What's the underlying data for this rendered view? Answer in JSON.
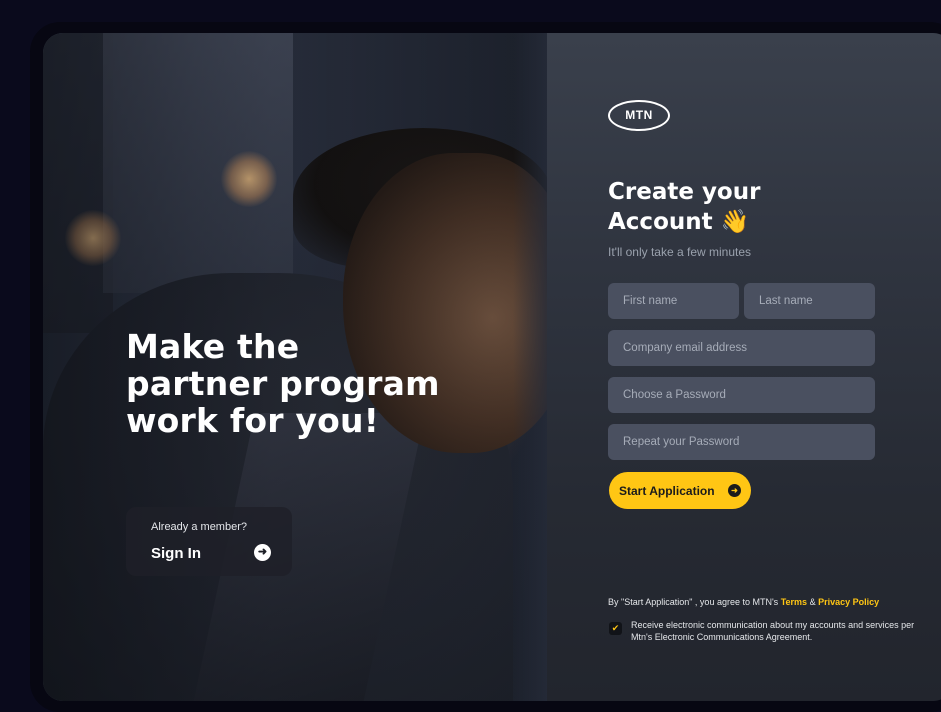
{
  "hero": {
    "headline_line1": "Make the",
    "headline_line2": "partner program",
    "headline_line3": "work for you!"
  },
  "signin": {
    "prompt": "Already a member?",
    "label": "Sign In",
    "arrow_icon": "arrow-right-circle-icon"
  },
  "form": {
    "logo_text": "MTN",
    "title_line1": "Create your",
    "title_line2": "Account",
    "title_emoji": "👋",
    "subtitle": "It'll only take a few minutes",
    "first_name_placeholder": "First name",
    "last_name_placeholder": "Last name",
    "email_placeholder": "Company email address",
    "password_placeholder": "Choose a Password",
    "repeat_password_placeholder": "Repeat your Password",
    "submit_label": "Start Application",
    "legal_prefix": "By \"Start Application\" , you agree to MTN's",
    "terms_link": "Terms",
    "amp": "&",
    "privacy_link": "Privacy Policy",
    "consent_checked": true,
    "consent_text": "Receive electronic communication about my accounts and services per Mtn's Electronic Communications Agreement."
  },
  "colors": {
    "accent": "#ffc614",
    "panel": "#2f343f",
    "field": "#4a5060"
  }
}
